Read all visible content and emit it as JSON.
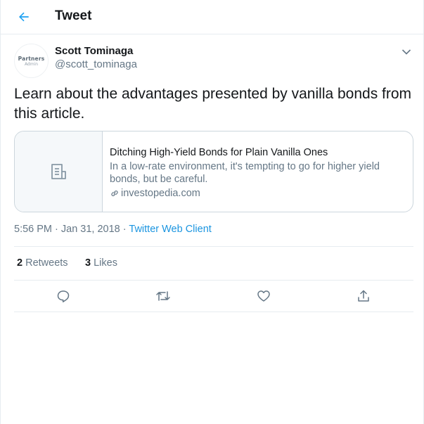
{
  "header": {
    "title": "Tweet",
    "back_icon": "arrow-left-icon"
  },
  "author": {
    "name": "Scott Tominaga",
    "handle": "@scott_tominaga",
    "avatar_logo_top": "Partners",
    "avatar_logo_bottom": "Admin"
  },
  "tweet": {
    "text": "Learn about the advantages presented by vanilla bonds from this article."
  },
  "card": {
    "title": "Ditching High-Yield Bonds for Plain Vanilla Ones",
    "description": "In a low-rate environment, it's tempting to go for higher yield bonds, but be careful.",
    "domain": "investopedia.com",
    "thumb_icon": "document-icon"
  },
  "meta": {
    "timestamp": "5:56 PM · Jan 31, 2018",
    "separator": "·",
    "client": "Twitter Web Client"
  },
  "stats": {
    "retweets_count": "2",
    "retweets_label": "Retweets",
    "likes_count": "3",
    "likes_label": "Likes"
  },
  "actions": [
    "reply-icon",
    "retweet-icon",
    "like-icon",
    "share-icon"
  ],
  "colors": {
    "accent": "#1da1f2",
    "text": "#14171a",
    "secondary": "#657786",
    "border": "#e6ecf0"
  }
}
